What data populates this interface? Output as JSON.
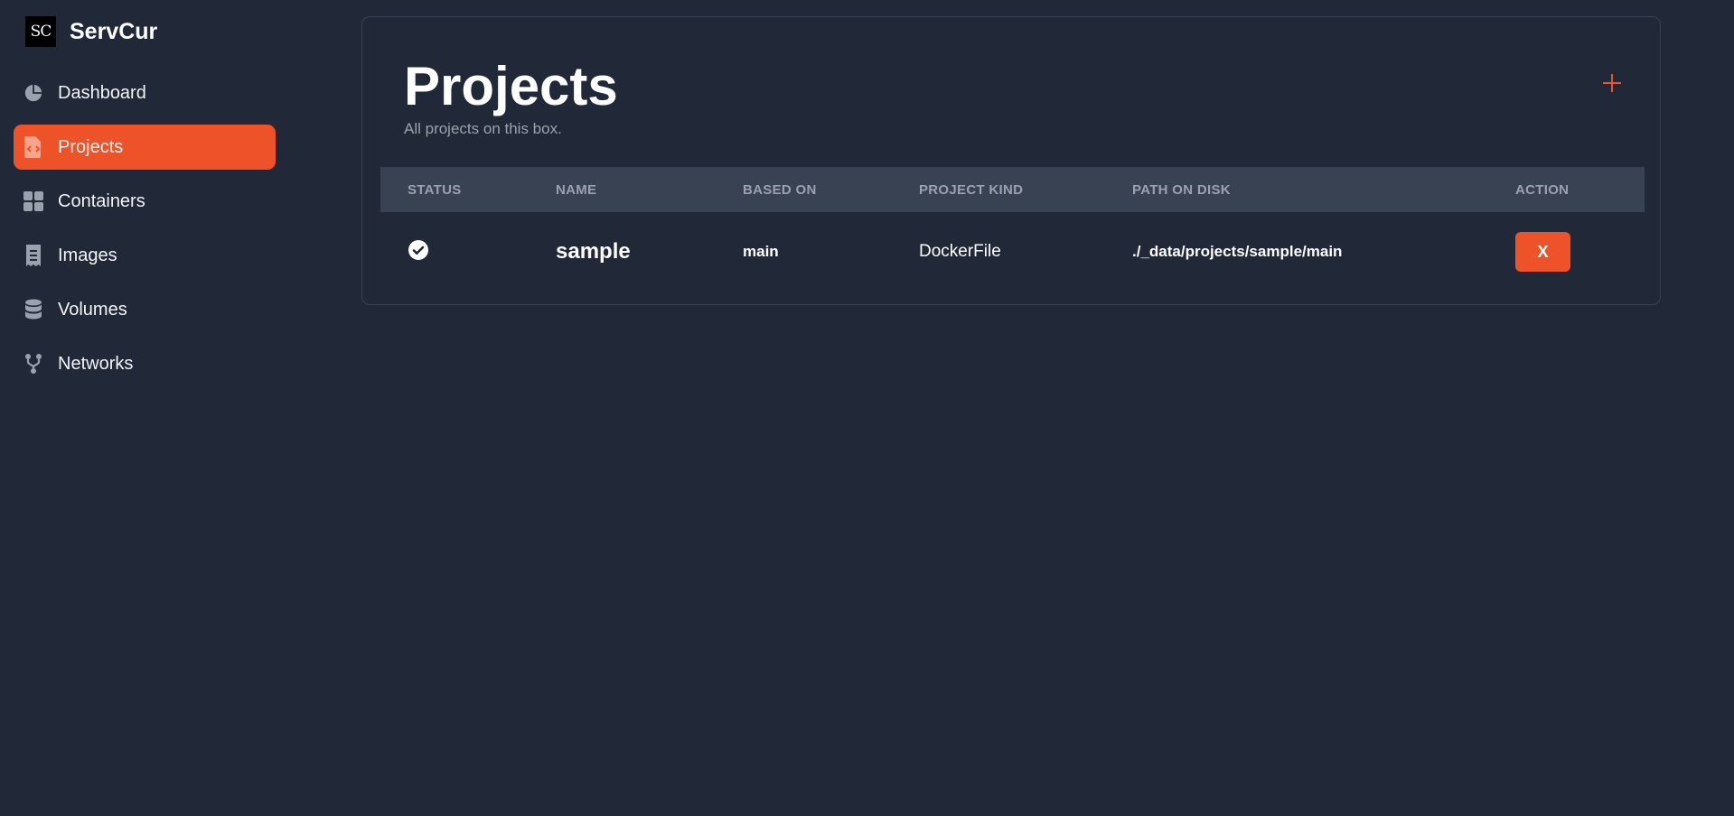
{
  "brand": {
    "logo_text": "SC",
    "name": "ServCur"
  },
  "sidebar": {
    "items": [
      {
        "label": "Dashboard",
        "icon": "pie-chart-icon"
      },
      {
        "label": "Projects",
        "icon": "code-file-icon",
        "active": true
      },
      {
        "label": "Containers",
        "icon": "grid-icon"
      },
      {
        "label": "Images",
        "icon": "receipt-icon"
      },
      {
        "label": "Volumes",
        "icon": "database-icon"
      },
      {
        "label": "Networks",
        "icon": "fork-icon"
      }
    ]
  },
  "page": {
    "title": "Projects",
    "subtitle": "All projects on this box.",
    "add_icon": "plus-icon"
  },
  "table": {
    "headers": [
      "STATUS",
      "NAME",
      "BASED ON",
      "PROJECT KIND",
      "PATH ON DISK",
      "ACTION"
    ],
    "rows": [
      {
        "status_icon": "check-circle-icon",
        "name": "sample",
        "based_on": "main",
        "kind": "DockerFile",
        "path": "./_data/projects/sample/main",
        "action_label": "X"
      }
    ]
  },
  "colors": {
    "background": "#212838",
    "accent": "#ee5228",
    "header_row": "#384253",
    "muted_text": "#9aa2af"
  }
}
